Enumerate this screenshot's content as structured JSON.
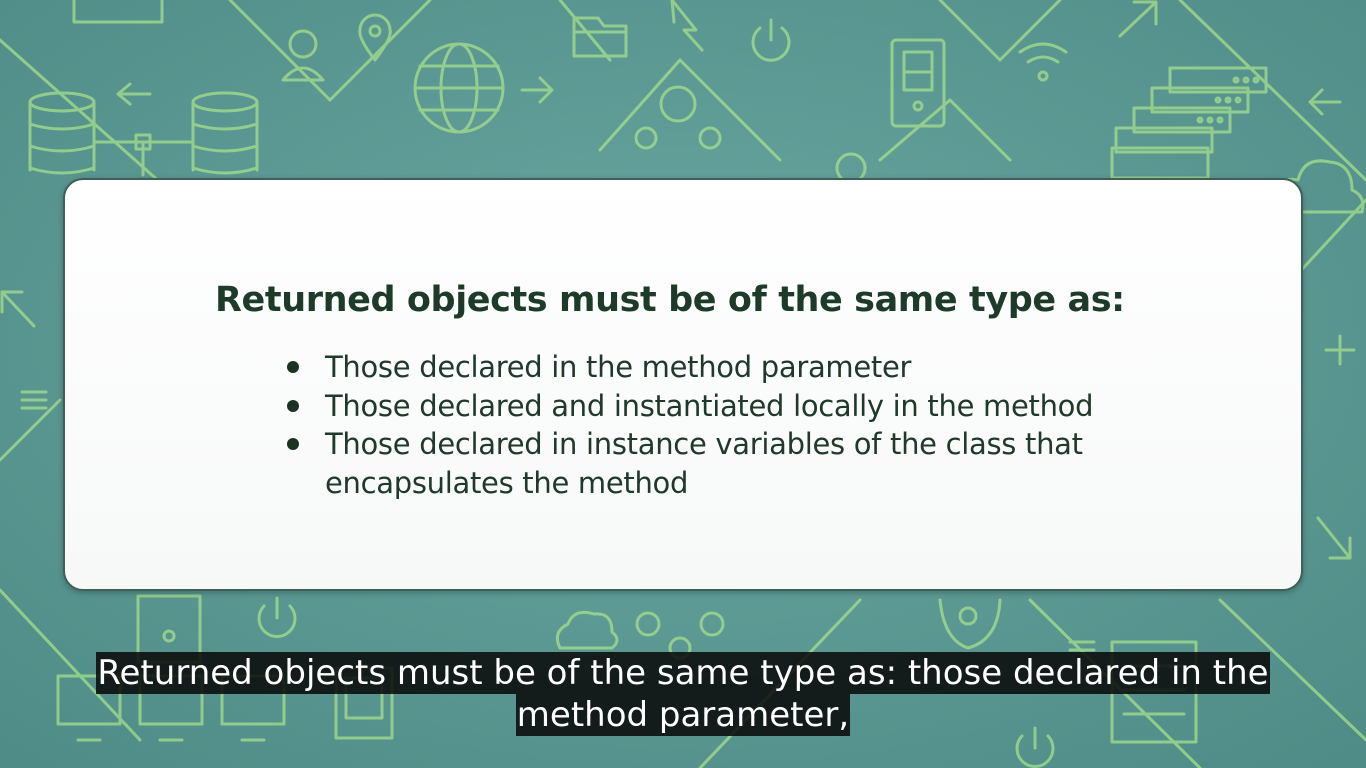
{
  "slide": {
    "title": "Returned objects must be of the same type as:",
    "bullets": [
      {
        "line1": "Those declared in the method parameter",
        "line2": ""
      },
      {
        "line1": "Those declared and instantiated locally in the method",
        "line2": ""
      },
      {
        "line1": "Those declared in instance variables of the class that",
        "line2": "encapsulates the method"
      }
    ]
  },
  "caption": {
    "line1": "Returned objects must be of the same type as: those declared in the",
    "line2": "method parameter,"
  },
  "colors": {
    "background": "#5f9a96",
    "pattern": "#a5e08c",
    "title": "#1e3a28",
    "card_border": "#3f5f58"
  }
}
